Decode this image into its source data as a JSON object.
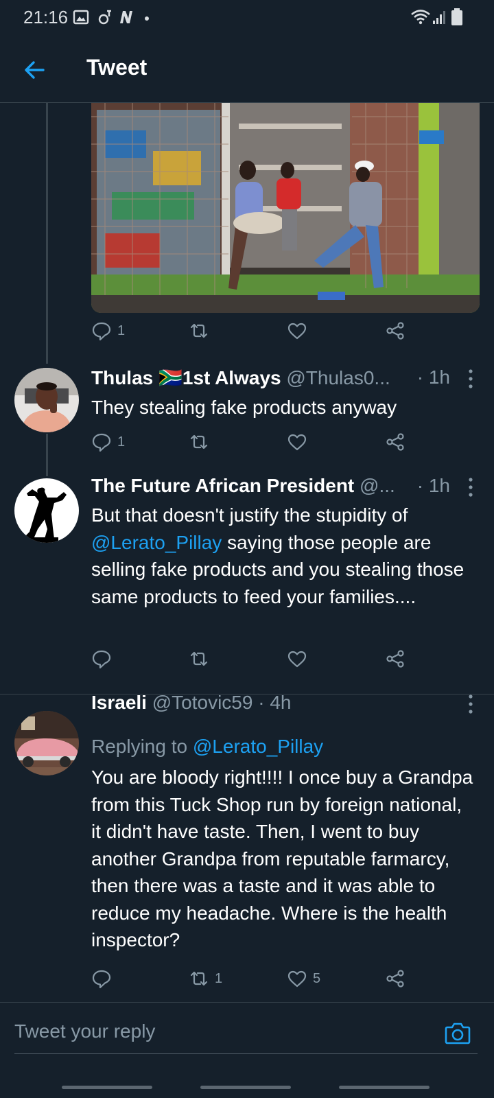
{
  "status_bar": {
    "time": "21:16"
  },
  "header": {
    "title": "Tweet"
  },
  "media_tweet": {
    "reply_count": "1",
    "retweet_count": "",
    "like_count": ""
  },
  "replies": [
    {
      "name": "Thulas 🇿🇦1st Always",
      "handle": "@Thulas0...",
      "time": "· 1h",
      "text": "They stealing fake products anyway",
      "reply_count": "1",
      "retweet_count": "",
      "like_count": ""
    },
    {
      "name": "The Future African President",
      "handle": "@...",
      "time": "· 1h",
      "text_parts": [
        "But that doesn't justify the stupidity of ",
        "@Lerato_Pillay",
        " saying those people are selling fake products and you stealing those same products to feed your families...."
      ],
      "reply_count": "",
      "retweet_count": "",
      "like_count": ""
    },
    {
      "name": "Israeli",
      "handle": "@Totovic59",
      "time": "· 4h",
      "replying_prefix": "Replying to ",
      "replying_to": "@Lerato_Pillay",
      "text": "You are bloody right!!!! I once buy a Grandpa from this Tuck Shop run by foreign national, it didn't have taste. Then, I went to buy another Grandpa from reputable farmarcy, then there was a taste and it was able to reduce my headache. Where is the health inspector?",
      "reply_count": "",
      "retweet_count": "1",
      "like_count": "5"
    }
  ],
  "reply_bar": {
    "placeholder": "Tweet your reply"
  },
  "colors": {
    "background": "#15202b",
    "accent": "#1da1f2",
    "muted": "#8899a6",
    "divider": "#38444d"
  }
}
